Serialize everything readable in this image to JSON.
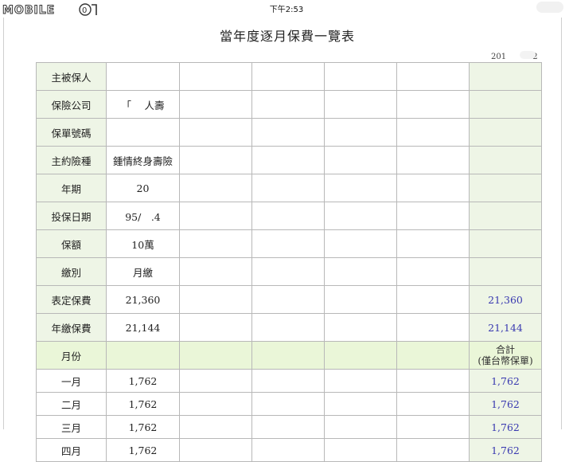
{
  "status_bar": {
    "time": "下午2:53"
  },
  "watermark": {
    "text": "MOBILE01"
  },
  "document": {
    "title": "當年度逐月保費一覽表",
    "date": "201　　　.2"
  },
  "rows": [
    {
      "label": "主被保人",
      "value": "",
      "total": ""
    },
    {
      "label": "保險公司",
      "value": "「　 人壽",
      "total": ""
    },
    {
      "label": "保單號碼",
      "value": "",
      "total": ""
    },
    {
      "label": "主約險種",
      "value": "鍾情終身壽險",
      "total": ""
    },
    {
      "label": "年期",
      "value": "20",
      "total": ""
    },
    {
      "label": "投保日期",
      "value": "95/　.4",
      "total": ""
    },
    {
      "label": "保額",
      "value": "10萬",
      "total": ""
    },
    {
      "label": "繳別",
      "value": "月繳",
      "total": ""
    },
    {
      "label": "表定保費",
      "value": "21,360",
      "total": "21,360"
    },
    {
      "label": "年繳保費",
      "value": "21,144",
      "total": "21,144"
    }
  ],
  "month_header": {
    "label": "月份",
    "total_line1": "合計",
    "total_line2": "(僅台幣保單)"
  },
  "months": [
    {
      "label": "一月",
      "value": "1,762",
      "total": "1,762"
    },
    {
      "label": "二月",
      "value": "1,762",
      "total": "1,762"
    },
    {
      "label": "三月",
      "value": "1,762",
      "total": "1,762"
    },
    {
      "label": "四月",
      "value": "1,762",
      "total": "1,762"
    }
  ]
}
